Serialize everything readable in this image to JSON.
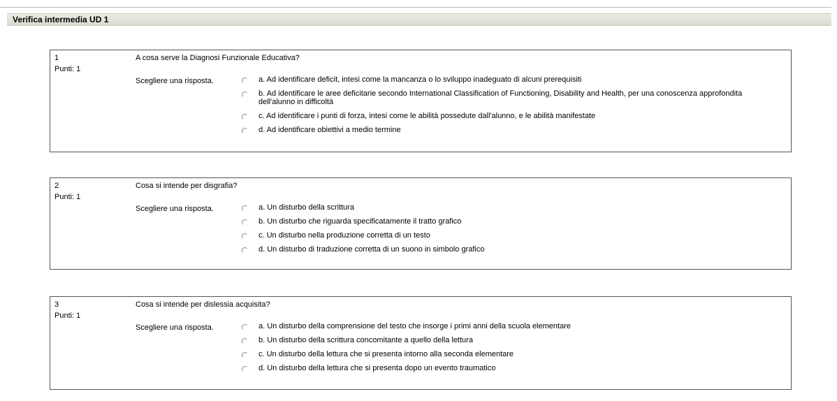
{
  "header": {
    "title": "Verifica intermedia UD 1"
  },
  "questions": [
    {
      "number": "1",
      "points": "Punti: 1",
      "text": "A cosa serve la Diagnosi Funzionale Educativa?",
      "prompt": "Scegliere una risposta.",
      "answers": [
        "a. Ad identificare deficit, intesi come la mancanza o lo sviluppo inadeguato di alcuni prerequisiti",
        "b. Ad identificare le aree deficitarie secondo International Classification of Functioning, Disability and Health, per una conoscenza approfondita dell'alunno in difficoltà",
        "c. Ad identificare i punti di forza, intesi come le abilità possedute dall'alunno, e le abilità manifestate",
        "d. Ad identificare obiettivi a medio termine"
      ]
    },
    {
      "number": "2",
      "points": "Punti: 1",
      "text": "Cosa si intende per disgrafia?",
      "prompt": "Scegliere una risposta.",
      "answers": [
        "a. Un disturbo della scrittura",
        "b. Un disturbo che riguarda specificatamente il tratto grafico",
        "c. Un disturbo nella produzione corretta di un testo",
        "d. Un disturbo di traduzione corretta di un suono in simbolo grafico"
      ]
    },
    {
      "number": "3",
      "points": "Punti: 1",
      "text": "Cosa si intende per dislessia acquisita?",
      "prompt": "Scegliere una risposta.",
      "answers": [
        "a. Un disturbo della comprensione del testo che insorge i primi anni della scuola elementare",
        "b. Un disturbo della scrittura concomitante a quello della lettura",
        "c. Un disturbo della lettura che si presenta intorno alla seconda elementare",
        "d. Un disturbo della lettura che si presenta dopo un evento traumatico"
      ]
    }
  ]
}
